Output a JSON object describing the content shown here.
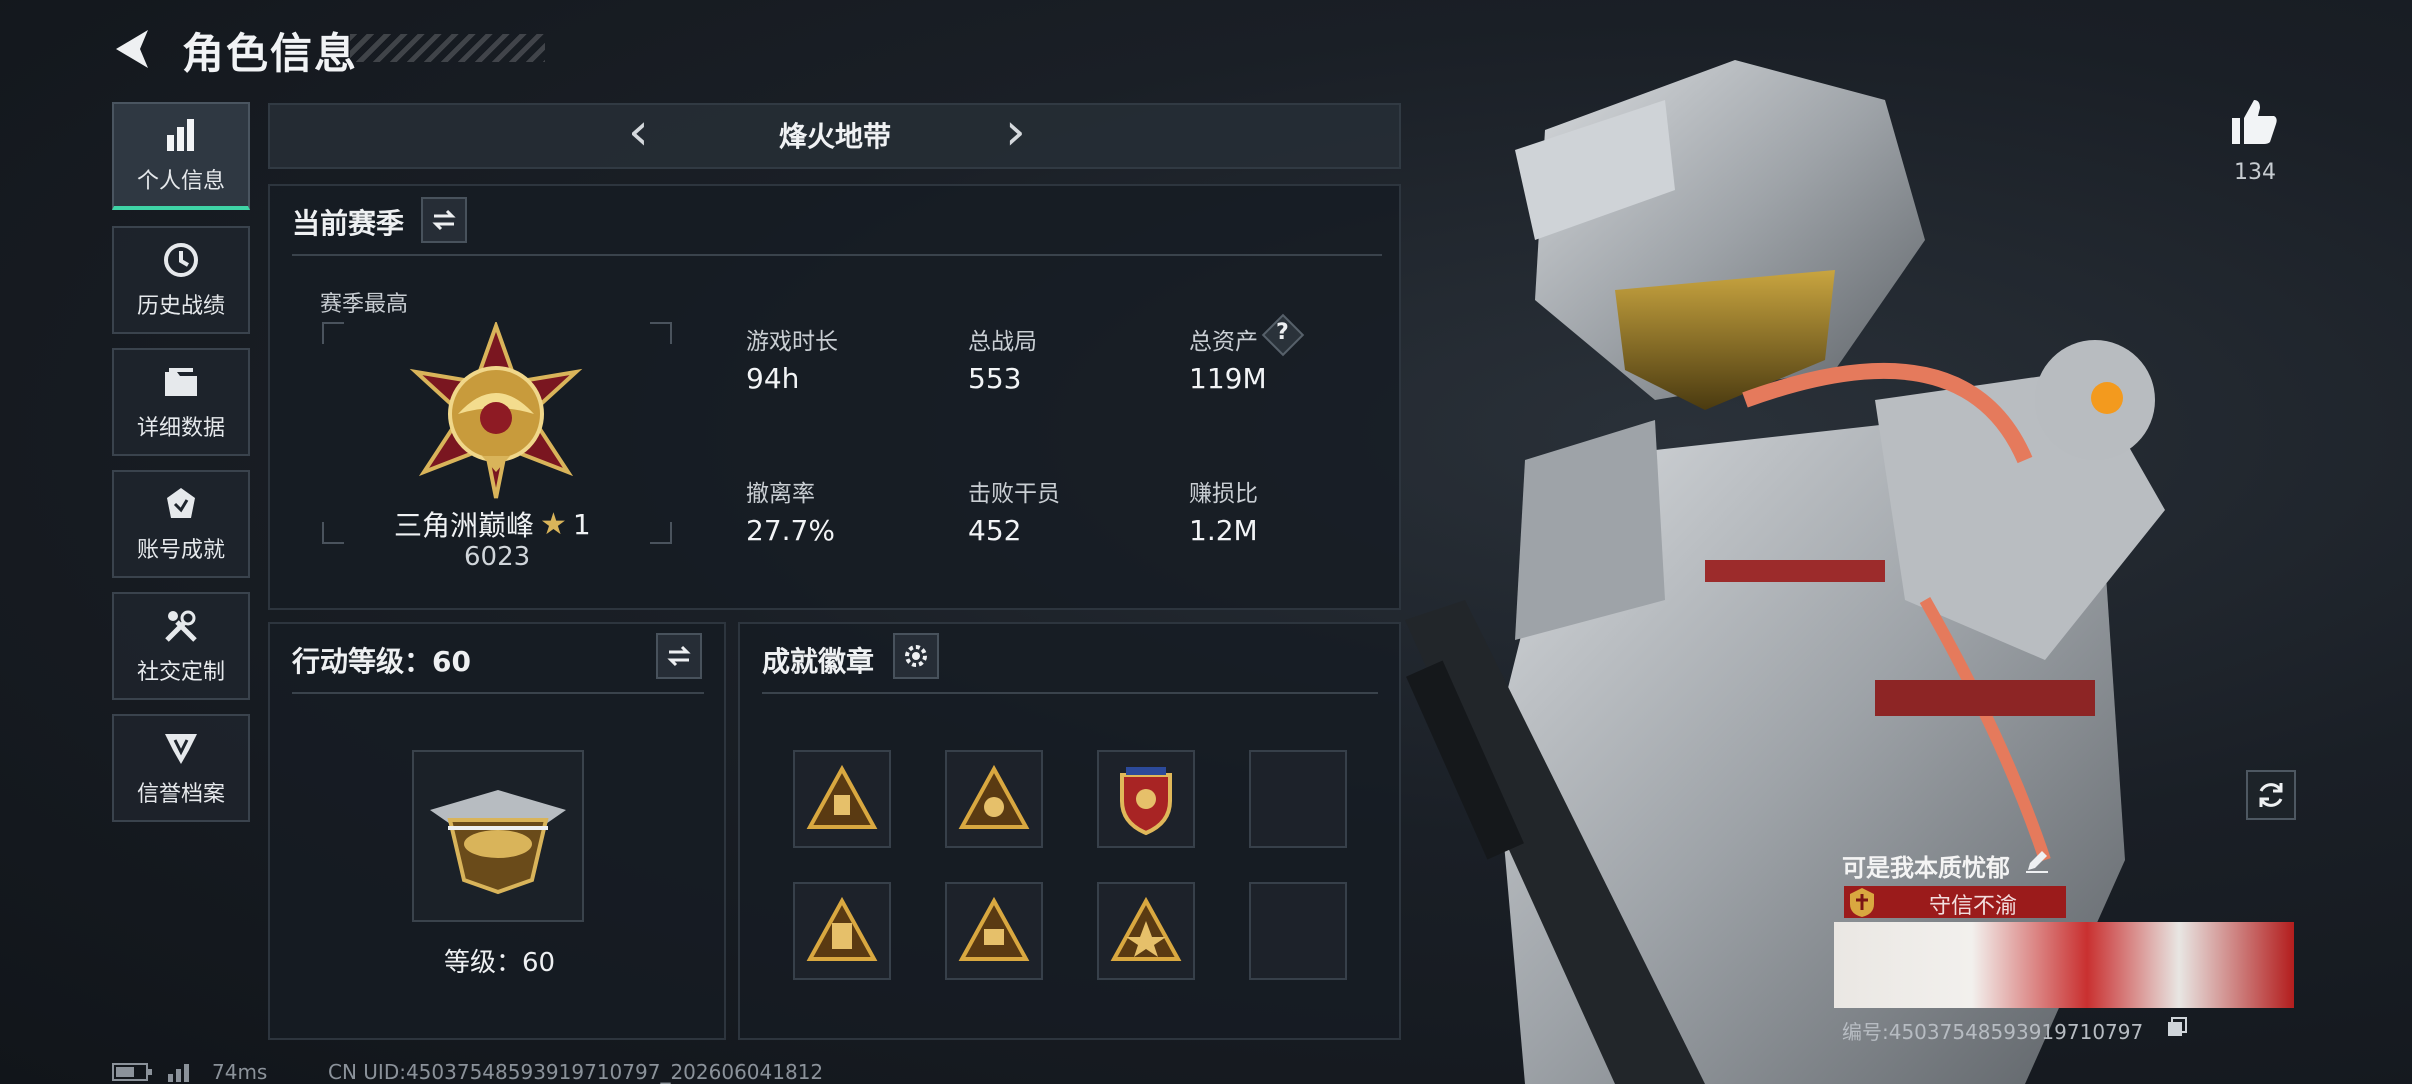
{
  "header": {
    "title": "角色信息"
  },
  "sidebar": {
    "items": [
      {
        "label": "个人信息",
        "icon": "bar-chart-icon",
        "active": true
      },
      {
        "label": "历史战绩",
        "icon": "history-clock-icon",
        "active": false
      },
      {
        "label": "详细数据",
        "icon": "folder-icon",
        "active": false
      },
      {
        "label": "账号成就",
        "icon": "achievement-icon",
        "active": false
      },
      {
        "label": "社交定制",
        "icon": "tools-icon",
        "active": false
      },
      {
        "label": "信誉档案",
        "icon": "reputation-icon",
        "active": false
      }
    ]
  },
  "mode": {
    "title": "烽火地带"
  },
  "season": {
    "title": "当前赛季",
    "best_label": "赛季最高",
    "rank_name": "三角洲巅峰",
    "rank_stars": "1",
    "rank_score": "6023",
    "stats": [
      {
        "label": "游戏时长",
        "value": "94h"
      },
      {
        "label": "总战局",
        "value": "553"
      },
      {
        "label": "总资产",
        "value": "119M"
      },
      {
        "label": "撤离率",
        "value": "27.7%"
      },
      {
        "label": "击败干员",
        "value": "452"
      },
      {
        "label": "赚损比",
        "value": "1.2M"
      }
    ]
  },
  "action_level": {
    "title": "行动等级：60",
    "level_text": "等级：60"
  },
  "badges": {
    "title": "成就徽章"
  },
  "profile": {
    "likes": "134",
    "name": "可是我本质忧郁",
    "reputation": "守信不渝",
    "id_text": "编号:4503754859391971079​7"
  },
  "status_bar": {
    "ping": "74ms",
    "uid": "CN UID:4503754859391971079​7_202606041812"
  },
  "colors": {
    "accent": "#3fd4a6",
    "reputation": "#9b1b1b"
  }
}
